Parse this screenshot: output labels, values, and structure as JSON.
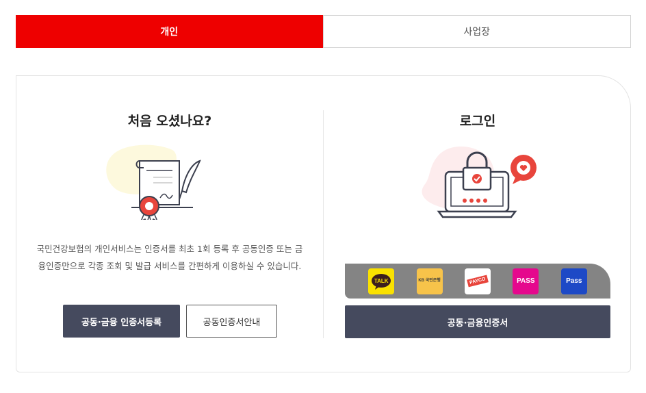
{
  "tabs": {
    "personal": "개인",
    "business": "사업장"
  },
  "left": {
    "heading": "처음 오셨나요?",
    "description": "국민건강보험의 개인서비스는 인증서를 최초 1회 등록 후 공동인증 또는 금융인증만으로 각종 조회 및 발급 서비스를 간편하게 이용하실 수 있습니다.",
    "register_button": "공동·금융 인증서등록",
    "guide_button": "공동인증서안내"
  },
  "right": {
    "heading": "로그인",
    "providers": [
      {
        "name": "kakao",
        "label": "TALK",
        "icon": "kakaotalk-icon"
      },
      {
        "name": "kb",
        "label": "KB 국민은행",
        "icon": "kb-bank-icon"
      },
      {
        "name": "payco",
        "label": "PAYCO",
        "icon": "payco-icon"
      },
      {
        "name": "pass",
        "label": "PASS",
        "icon": "pass-icon"
      },
      {
        "name": "samsung-pass",
        "label": "Pass",
        "icon": "samsung-pass-icon"
      }
    ],
    "cert_button": "공동·금융인증서"
  },
  "colors": {
    "accent": "#ee0000",
    "button_dark": "#454a5e",
    "provider_bar": "#848484"
  }
}
